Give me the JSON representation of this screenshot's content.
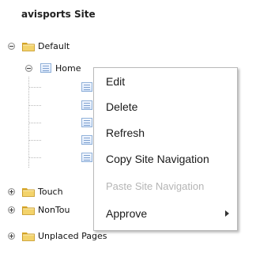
{
  "site": {
    "title": "avisports Site"
  },
  "tree": {
    "default_label": "Default",
    "home_label": "Home",
    "touch_label": "Touch",
    "nontouch_label": "NonTou",
    "unplaced_label": "Unplaced Pages"
  },
  "context_menu": {
    "items": [
      {
        "label": "Edit",
        "enabled": true
      },
      {
        "label": "Delete",
        "enabled": true
      },
      {
        "label": "Refresh",
        "enabled": true
      },
      {
        "label": "Copy Site Navigation",
        "enabled": true
      },
      {
        "label": "Paste Site Navigation",
        "enabled": false
      },
      {
        "label": "Approve",
        "enabled": true,
        "has_submenu": true
      }
    ]
  },
  "colors": {
    "folder_top": "#f0d47a",
    "folder_body": "#d9a827",
    "menu_disabled": "#b5b5b5"
  }
}
